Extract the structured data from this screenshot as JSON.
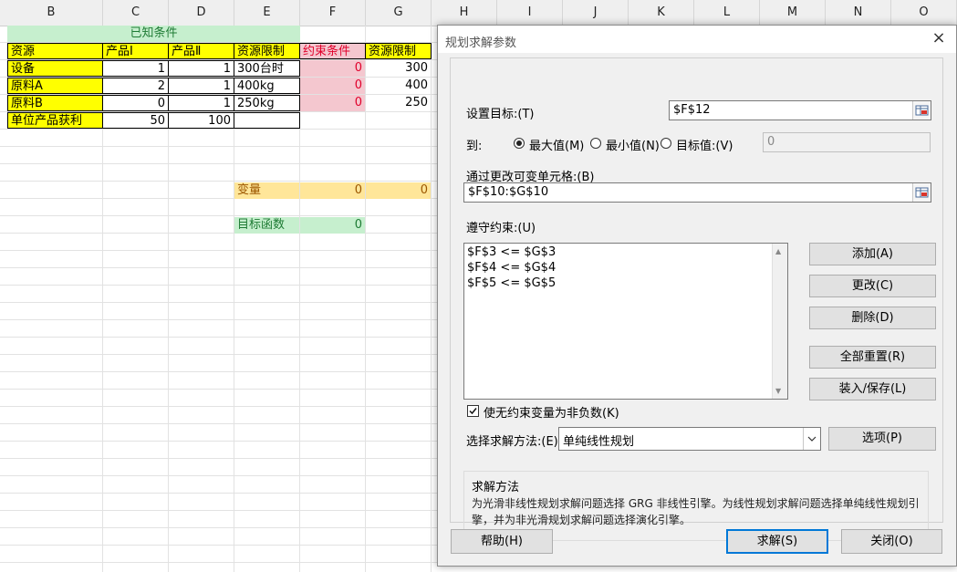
{
  "sheet": {
    "columns": [
      "B",
      "C",
      "D",
      "E",
      "F",
      "G",
      "H",
      "I",
      "J",
      "K",
      "L",
      "M",
      "N",
      "O"
    ],
    "known_title": "已知条件",
    "headers": [
      "资源",
      "产品Ⅰ",
      "产品Ⅱ",
      "资源限制",
      "约束条件",
      "资源限制"
    ],
    "rows": [
      [
        "设备",
        "1",
        "1",
        "300台时",
        "0",
        "300"
      ],
      [
        "原料A",
        "2",
        "1",
        "400kg",
        "0",
        "400"
      ],
      [
        "原料B",
        "0",
        "1",
        "250kg",
        "0",
        "250"
      ]
    ],
    "profit_row": [
      "单位产品获利",
      "50",
      "100"
    ],
    "variable_label": "变量",
    "variable_values": [
      "0",
      "0"
    ],
    "objective_label": "目标函数",
    "objective_value": "0"
  },
  "dialog": {
    "title": "规划求解参数",
    "set_objective_label": "设置目标:(T)",
    "set_objective_value": "$F$12",
    "to_label": "到:",
    "opt_max": "最大值(M)",
    "opt_min": "最小值(N)",
    "opt_value": "目标值:(V)",
    "target_value": "0",
    "changing_cells_label": "通过更改可变单元格:(B)",
    "changing_cells_value": "$F$10:$G$10",
    "constraints_label": "遵守约束:(U)",
    "constraints": [
      "$F$3 <= $G$3",
      "$F$4 <= $G$4",
      "$F$5 <= $G$5"
    ],
    "btn_add": "添加(A)",
    "btn_change": "更改(C)",
    "btn_delete": "删除(D)",
    "btn_reset": "全部重置(R)",
    "btn_load": "装入/保存(L)",
    "nonneg_label": "使无约束变量为非负数(K)",
    "method_label": "选择求解方法:(E)",
    "method_value": "单纯线性规划",
    "btn_options": "选项(P)",
    "desc_title": "求解方法",
    "desc_text": "为光滑非线性规划求解问题选择 GRG 非线性引擎。为线性规划求解问题选择单纯线性规划引擎，并为非光滑规划求解问题选择演化引擎。",
    "btn_help": "帮助(H)",
    "btn_solve": "求解(S)",
    "btn_close": "关闭(O)",
    "accent_color": "#0078d7"
  }
}
